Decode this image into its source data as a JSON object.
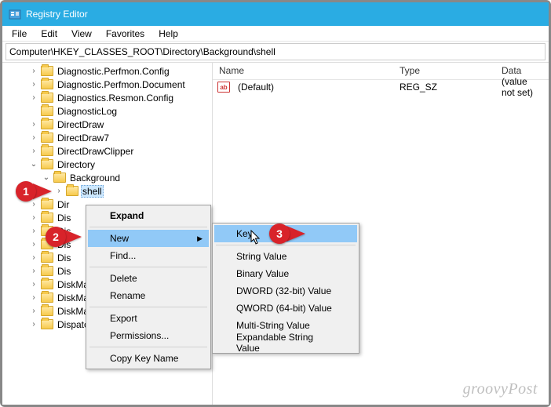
{
  "window": {
    "title": "Registry Editor"
  },
  "menubar": [
    "File",
    "Edit",
    "View",
    "Favorites",
    "Help"
  ],
  "address": "Computer\\HKEY_CLASSES_ROOT\\Directory\\Background\\shell",
  "list": {
    "headers": {
      "name": "Name",
      "type": "Type",
      "data": "Data"
    },
    "rows": [
      {
        "icon": "ab",
        "name": "(Default)",
        "type": "REG_SZ",
        "data": "(value not set)"
      }
    ]
  },
  "tree": [
    {
      "indent": 1,
      "exp": ">",
      "label": "Diagnostic.Perfmon.Config"
    },
    {
      "indent": 1,
      "exp": ">",
      "label": "Diagnostic.Perfmon.Document"
    },
    {
      "indent": 1,
      "exp": ">",
      "label": "Diagnostics.Resmon.Config"
    },
    {
      "indent": 1,
      "exp": "",
      "label": "DiagnosticLog"
    },
    {
      "indent": 1,
      "exp": ">",
      "label": "DirectDraw"
    },
    {
      "indent": 1,
      "exp": ">",
      "label": "DirectDraw7"
    },
    {
      "indent": 1,
      "exp": ">",
      "label": "DirectDrawClipper"
    },
    {
      "indent": 1,
      "exp": "v",
      "label": "Directory"
    },
    {
      "indent": 2,
      "exp": "v",
      "label": "Background"
    },
    {
      "indent": 3,
      "exp": ">",
      "label": "shell",
      "selected": true
    },
    {
      "indent": 1,
      "exp": ">",
      "label": "Dir"
    },
    {
      "indent": 1,
      "exp": ">",
      "label": "Dis"
    },
    {
      "indent": 1,
      "exp": ">",
      "label": "Dis"
    },
    {
      "indent": 1,
      "exp": ">",
      "label": "Dis"
    },
    {
      "indent": 1,
      "exp": ">",
      "label": "Dis"
    },
    {
      "indent": 1,
      "exp": ">",
      "label": "Dis"
    },
    {
      "indent": 1,
      "exp": ">",
      "label": "DiskManagement.SnapInCompo"
    },
    {
      "indent": 1,
      "exp": ">",
      "label": "DiskManagement.SnapInExtension"
    },
    {
      "indent": 1,
      "exp": ">",
      "label": "DiskManagement.UITasks"
    },
    {
      "indent": 1,
      "exp": ">",
      "label": "DispatchMapper DispatchMapper"
    }
  ],
  "context_menu": {
    "items": [
      {
        "label": "Expand",
        "bold": true
      },
      {
        "sep": true
      },
      {
        "label": "New",
        "hover": true,
        "submenu": true
      },
      {
        "label": "Find..."
      },
      {
        "sep": true
      },
      {
        "label": "Delete"
      },
      {
        "label": "Rename"
      },
      {
        "sep": true
      },
      {
        "label": "Export"
      },
      {
        "label": "Permissions..."
      },
      {
        "sep": true
      },
      {
        "label": "Copy Key Name"
      }
    ]
  },
  "submenu": {
    "items": [
      {
        "label": "Key",
        "hover": true
      },
      {
        "sep": true
      },
      {
        "label": "String Value"
      },
      {
        "label": "Binary Value"
      },
      {
        "label": "DWORD (32-bit) Value"
      },
      {
        "label": "QWORD (64-bit) Value"
      },
      {
        "label": "Multi-String Value"
      },
      {
        "label": "Expandable String Value"
      }
    ]
  },
  "callouts": {
    "1": "1",
    "2": "2",
    "3": "3"
  },
  "watermark": "groovyPost"
}
